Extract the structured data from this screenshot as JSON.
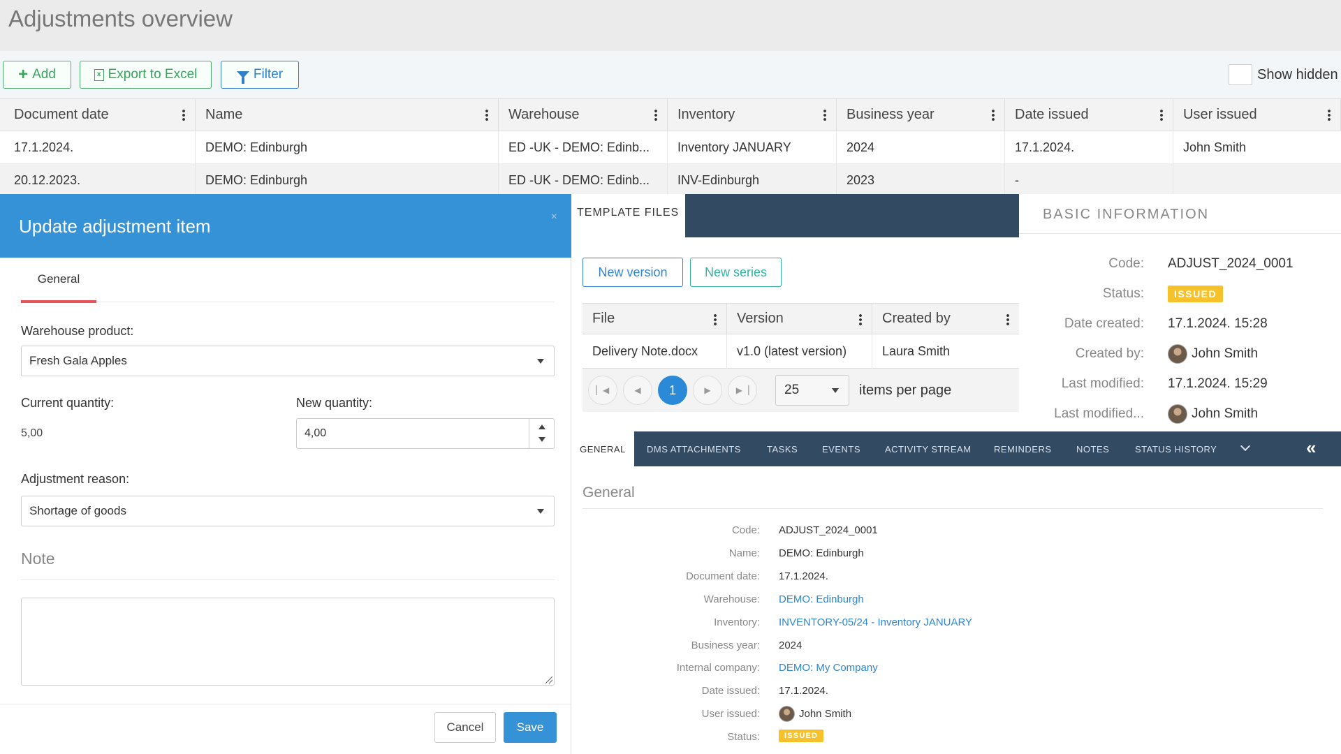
{
  "overview": {
    "title": "Adjustments overview",
    "toolbar": {
      "add_label": "Add",
      "export_label": "Export to Excel",
      "filter_label": "Filter",
      "show_hidden_label": "Show hidden"
    },
    "columns": [
      "Document date",
      "Name",
      "Warehouse",
      "Inventory",
      "Business year",
      "Date issued",
      "User issued"
    ],
    "rows": [
      [
        "17.1.2024.",
        "DEMO: Edinburgh",
        "ED -UK - DEMO: Edinb...",
        "Inventory JANUARY",
        "2024",
        "17.1.2024.",
        "John Smith"
      ],
      [
        "20.12.2023.",
        "DEMO: Edinburgh",
        "ED -UK - DEMO: Edinb...",
        "INV-Edinburgh",
        "2023",
        "-",
        ""
      ]
    ]
  },
  "dialog": {
    "title": "Update adjustment item",
    "close_icon": "×",
    "tab_general": "General",
    "warehouse_product_label": "Warehouse product:",
    "warehouse_product_value": "Fresh Gala Apples",
    "current_quantity_label": "Current quantity:",
    "current_quantity_value": "5,00",
    "new_quantity_label": "New quantity:",
    "new_quantity_value": "4,00",
    "adjustment_reason_label": "Adjustment reason:",
    "adjustment_reason_value": "Shortage of goods",
    "note_title": "Note",
    "note_value": "",
    "cancel_label": "Cancel",
    "save_label": "Save"
  },
  "template_files": {
    "tab_label": "TEMPLATE FILES",
    "new_version_label": "New version",
    "new_series_label": "New series",
    "columns": [
      "File",
      "Version",
      "Created by"
    ],
    "row": [
      "Delivery Note.docx",
      "v1.0 (latest version)",
      "Laura Smith"
    ],
    "pager": {
      "current_page": "1",
      "page_size": "25",
      "items_per_page_label": "items per page"
    }
  },
  "basic_info": {
    "title": "BASIC INFORMATION",
    "code_label": "Code:",
    "code_value": "ADJUST_2024_0001",
    "status_label": "Status:",
    "status_value": "ISSUED",
    "date_created_label": "Date created:",
    "date_created_value": "17.1.2024. 15:28",
    "created_by_label": "Created by:",
    "created_by_value": "John Smith",
    "last_modified_label": "Last modified:",
    "last_modified_value": "17.1.2024. 15:29",
    "last_modified_by_label": "Last modified...",
    "last_modified_by_value": "John Smith"
  },
  "detail": {
    "tabs": [
      "GENERAL",
      "DMS ATTACHMENTS",
      "TASKS",
      "EVENTS",
      "ACTIVITY STREAM",
      "REMINDERS",
      "NOTES",
      "STATUS HISTORY"
    ],
    "collapse_icon": "«",
    "section_title": "General",
    "fields": {
      "code_label": "Code:",
      "code_value": "ADJUST_2024_0001",
      "name_label": "Name:",
      "name_value": "DEMO: Edinburgh",
      "document_date_label": "Document date:",
      "document_date_value": "17.1.2024.",
      "warehouse_label": "Warehouse:",
      "warehouse_value": "DEMO: Edinburgh",
      "inventory_label": "Inventory:",
      "inventory_value": "INVENTORY-05/24 - Inventory JANUARY",
      "business_year_label": "Business year:",
      "business_year_value": "2024",
      "internal_company_label": "Internal company:",
      "internal_company_value": "DEMO: My Company",
      "date_issued_label": "Date issued:",
      "date_issued_value": "17.1.2024.",
      "user_issued_label": "User issued:",
      "user_issued_value": "John Smith",
      "status_label": "Status:",
      "status_value": "ISSUED"
    }
  }
}
